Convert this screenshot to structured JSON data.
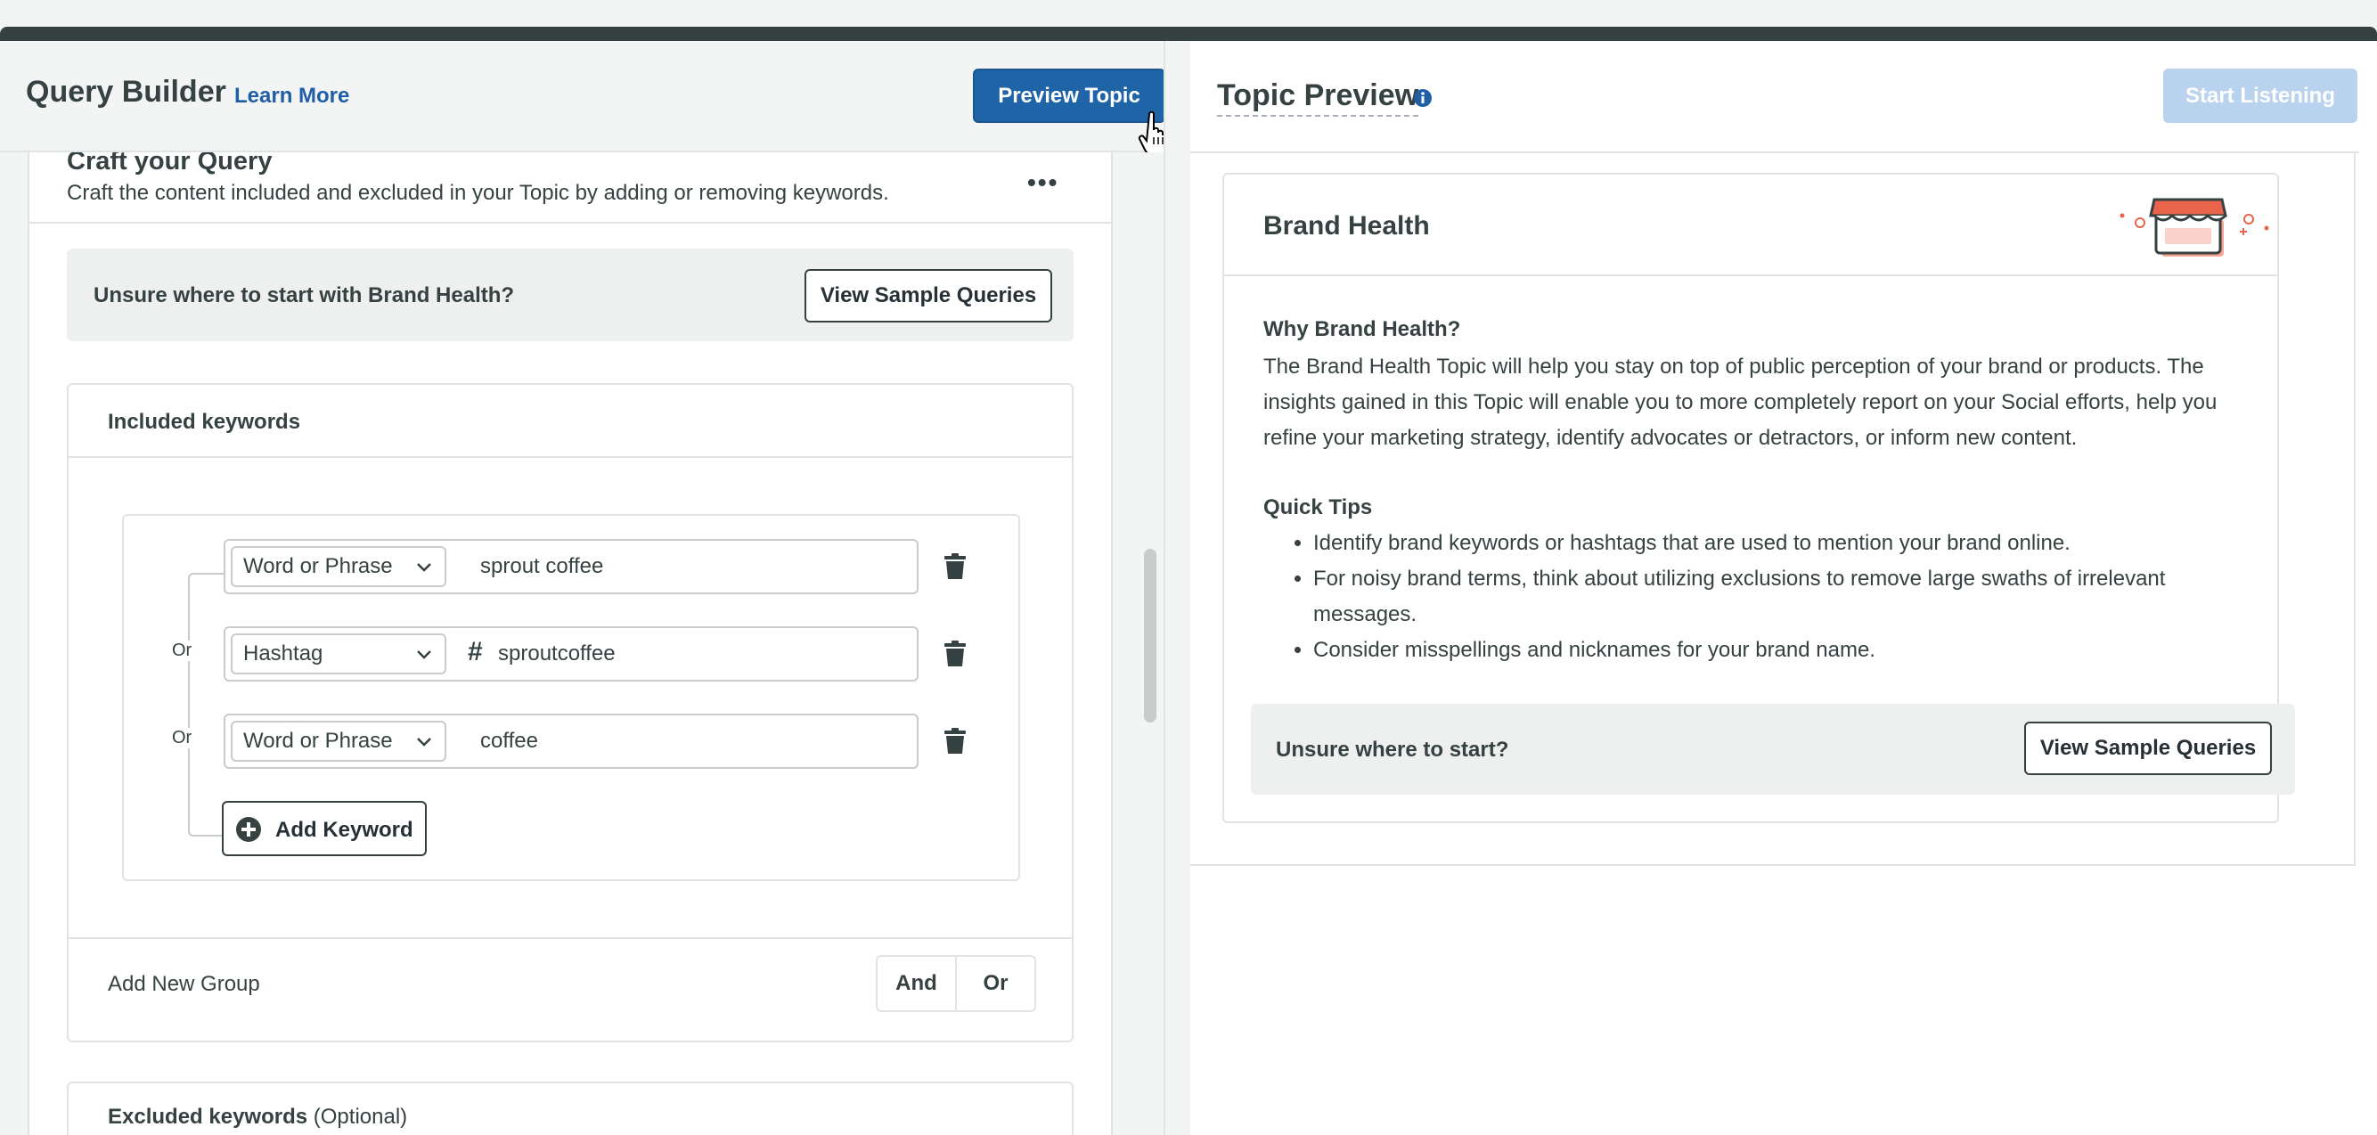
{
  "left": {
    "title": "Query Builder",
    "learn_more": "Learn More",
    "preview_button": "Preview Topic",
    "craft": {
      "title": "Craft your Query",
      "description": "Craft the content included and excluded in your Topic by adding or removing keywords.",
      "menu": "•••"
    },
    "unsure": {
      "text": "Unsure where to start with Brand Health?",
      "button": "View Sample Queries"
    },
    "included": {
      "title": "Included keywords",
      "connector": "Or",
      "keywords": [
        {
          "type": "Word or Phrase",
          "value": "sprout coffee"
        },
        {
          "type": "Hashtag",
          "prefix": "#",
          "value": "sproutcoffee"
        },
        {
          "type": "Word or Phrase",
          "value": "coffee"
        }
      ],
      "add_keyword": "Add Keyword",
      "add_group": "Add New Group",
      "and_label": "And",
      "or_label": "Or"
    },
    "excluded": {
      "title": "Excluded keywords",
      "optional": "(Optional)"
    }
  },
  "right": {
    "title": "Topic Preview",
    "start_button": "Start Listening",
    "card": {
      "title": "Brand Health",
      "why_title": "Why Brand Health?",
      "why_body": "The Brand Health Topic will help you stay on top of public perception of your brand or products. The insights gained in this Topic will enable you to more completely report on your Social efforts, help you refine your marketing strategy, identify advocates or detractors, or inform new content.",
      "tips_title": "Quick Tips",
      "tips": [
        "Identify brand keywords or hashtags that are used to mention your brand online.",
        "For noisy brand terms, think about utilizing exclusions to remove large swaths of irrelevant messages.",
        "Consider misspellings and nicknames for your brand name."
      ],
      "unsure_text": "Unsure where to start?",
      "unsure_button": "View Sample Queries"
    }
  },
  "colors": {
    "primary": "#2064a8",
    "primary_disabled": "#b9d3ee",
    "text": "#364141",
    "illustration": "#e8644a"
  },
  "icons": [
    "cursor-hand-icon",
    "ellipsis-icon",
    "chevron-down-icon",
    "trash-icon",
    "plus-circle-icon",
    "info-icon",
    "storefront-illustration"
  ]
}
